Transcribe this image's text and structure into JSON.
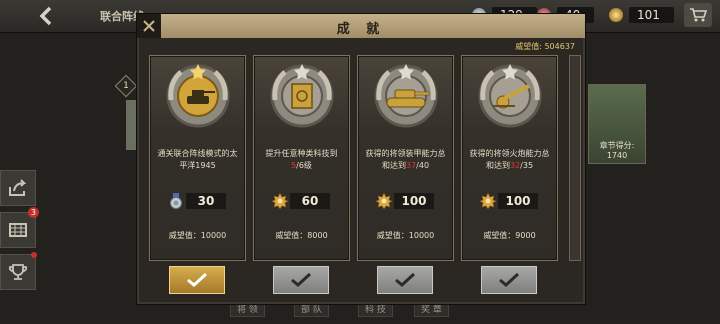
{
  "topbar": {
    "title": "联合阵线",
    "resources": [
      {
        "icon": "silver-medal-icon",
        "value": "129"
      },
      {
        "icon": "red-medal-icon",
        "value": "40"
      },
      {
        "icon": "gold-star-medal-icon",
        "value": "101"
      }
    ]
  },
  "side": {
    "mail_badge": "3"
  },
  "background": {
    "stage_number": "1",
    "chapter_score_label": "章节得分:",
    "chapter_score_value": "1740",
    "tabs": [
      "将 领",
      "部 队",
      "科 技",
      "奖 章"
    ]
  },
  "modal": {
    "title": "成 就",
    "prestige_label": "威望值: ",
    "prestige_value": "504637",
    "achievements": [
      {
        "icon": "golden-tank-medal-icon",
        "desc_pre": "通关联合阵线模式的太平洋1945",
        "highlight": "",
        "desc_post": "",
        "reward_icon": "silver-medal-icon",
        "reward": "30",
        "prestige_line": "威望值：10000",
        "state": "active"
      },
      {
        "icon": "research-book-medal-icon",
        "desc_pre": "提升任意种类科技到",
        "highlight": "5",
        "desc_post": "/6级",
        "reward_icon": "gold-star-medal-icon",
        "reward": "60",
        "prestige_line": "威望值：8000",
        "state": "done"
      },
      {
        "icon": "tank-medal-icon",
        "desc_pre": "获得的将领装甲能力总和达到",
        "highlight": "37",
        "desc_post": "/40",
        "reward_icon": "gold-star-medal-icon",
        "reward": "100",
        "prestige_line": "威望值：10000",
        "state": "done"
      },
      {
        "icon": "artillery-medal-icon",
        "desc_pre": "获得的将领火炮能力总和达到",
        "highlight": "32",
        "desc_post": "/35",
        "reward_icon": "gold-star-medal-icon",
        "reward": "100",
        "prestige_line": "威望值：9000",
        "state": "done"
      }
    ]
  }
}
